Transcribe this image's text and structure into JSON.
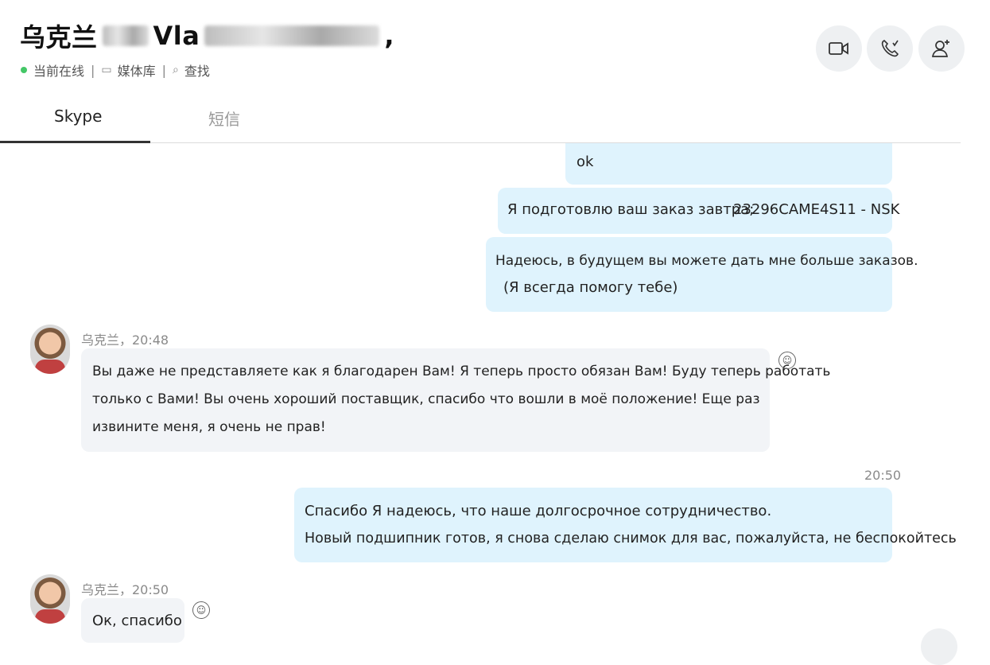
{
  "header": {
    "title_prefix": "乌克兰",
    "title_name": "Vla",
    "title_suffix": ",",
    "status": "当前在线",
    "separator": "|",
    "media": "媒体库",
    "find": "查找",
    "online_color": "#44c767"
  },
  "actions": {
    "video_icon": "video-camera-icon",
    "call_icon": "phone-call-icon",
    "add_contact_icon": "add-contact-icon"
  },
  "tabs": [
    {
      "label": "Skype",
      "active": true
    },
    {
      "label": "短信",
      "active": false
    }
  ],
  "messages": {
    "m1": "ok",
    "m2_text": "Я подготовлю ваш заказ завтра;",
    "m2_code": "23296CAME4S11 - NSK",
    "m3_line1": "Надеюсь, в будущем вы можете дать мне больше заказов.",
    "m3_line2": "(Я всегда помогу тебе)",
    "m4_meta": "乌克兰，20:48",
    "m4_line1": "Вы даже не представляете как я благодарен Вам! Я теперь просто обязан Вам! Буду теперь работать",
    "m4_line2": "только с Вами! Вы очень хороший поставщик,  спасибо что вошли в моё положение! Еще раз",
    "m4_line3": "извините меня, я очень не прав!",
    "m5_time": "20:50",
    "m5_line1": "Спасибо Я надеюсь, что наше долгосрочное сотрудничество.",
    "m5_line2": "Новый подшипник готов, я снова сделаю снимок для вас, пожалуйста, не беспокойтесь",
    "m6_meta": "乌克兰，20:50",
    "m6_text": "Ок, спасибо"
  }
}
